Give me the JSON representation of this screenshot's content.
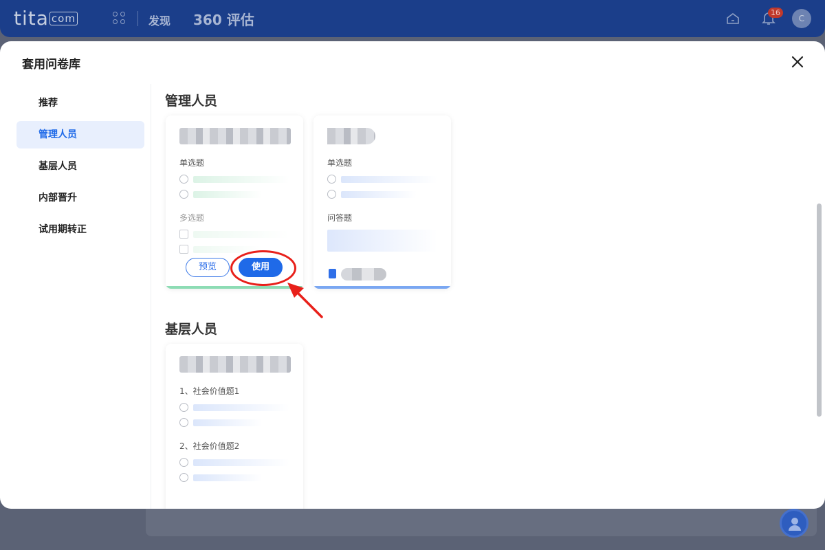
{
  "app": {
    "logo_text": "tita",
    "logo_domain": "com",
    "nav_discover": "发现",
    "nav_current": "360 评估",
    "notification_count": "16",
    "user_initial": "C"
  },
  "modal": {
    "title": "套用问卷库"
  },
  "sidebar": {
    "items": [
      {
        "label": "推荐",
        "active": false
      },
      {
        "label": "管理人员",
        "active": true
      },
      {
        "label": "基层人员",
        "active": false
      },
      {
        "label": "内部晋升",
        "active": false
      },
      {
        "label": "试用期转正",
        "active": false
      }
    ]
  },
  "sections": [
    {
      "title": "管理人员",
      "cards": [
        {
          "accent": "#8ddcb4",
          "q1_label": "单选题",
          "q2_label": "多选题",
          "preview_label": "预览",
          "use_label": "使用"
        },
        {
          "accent": "#7aa7f2",
          "q1_label": "单选题",
          "q2_label": "问答题"
        }
      ]
    },
    {
      "title": "基层人员",
      "cards": [
        {
          "q1_label": "1、社会价值题1",
          "q2_label": "2、社会价值题2"
        }
      ]
    }
  ],
  "colors": {
    "primary": "#1f6ae8",
    "highlight_ring": "#e8201a"
  }
}
